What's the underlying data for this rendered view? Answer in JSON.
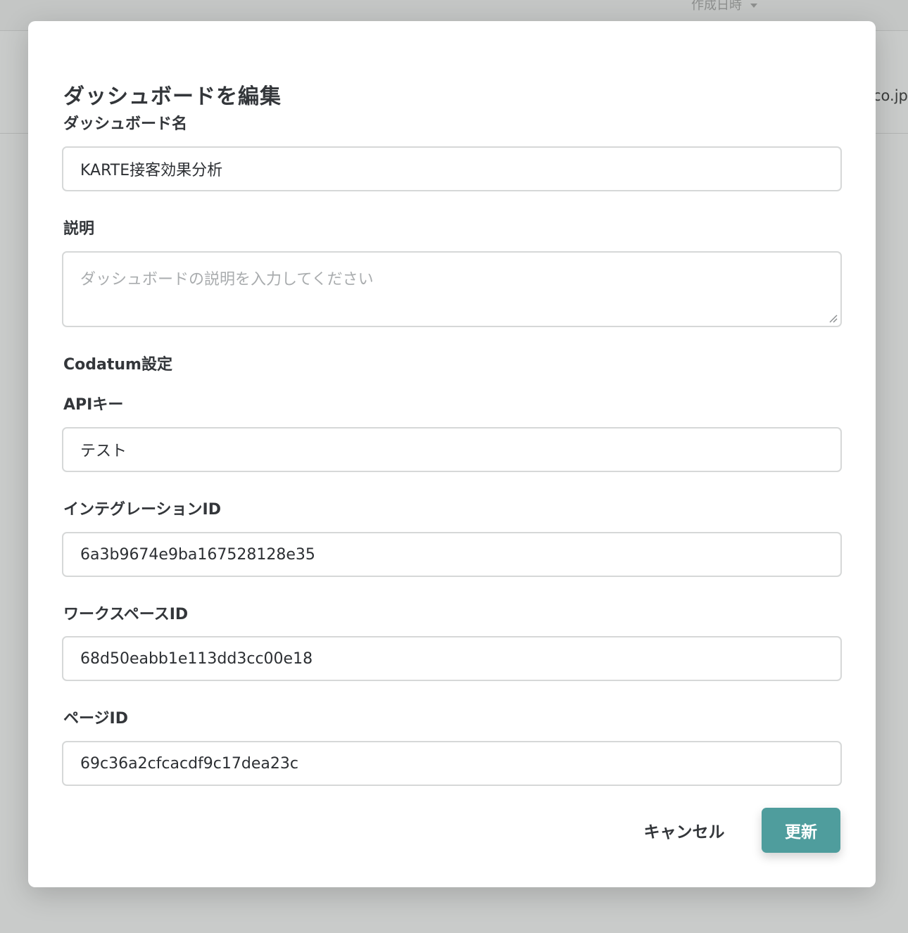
{
  "background": {
    "sort_label": "作成日時",
    "row_text_1": ")",
    "row_text_2": "co.jp"
  },
  "modal": {
    "title": "ダッシュボードを編集",
    "dashboard_name": {
      "label": "ダッシュボード名",
      "value": "KARTE接客効果分析"
    },
    "description": {
      "label": "説明",
      "placeholder": "ダッシュボードの説明を入力してください",
      "value": ""
    },
    "codatum_section": "Codatum設定",
    "api_key": {
      "label": "APIキー",
      "value": "テスト"
    },
    "integration_id": {
      "label": "インテグレーションID",
      "value": "6a3b9674e9ba167528128e35"
    },
    "workspace_id": {
      "label": "ワークスペースID",
      "value": "68d50eabb1e113dd3cc00e18"
    },
    "page_id": {
      "label": "ページID",
      "value": "69c36a2cfcacdf9c17dea23c"
    },
    "cancel_label": "キャンセル",
    "update_label": "更新",
    "accent_color": "#4f9d9d"
  }
}
